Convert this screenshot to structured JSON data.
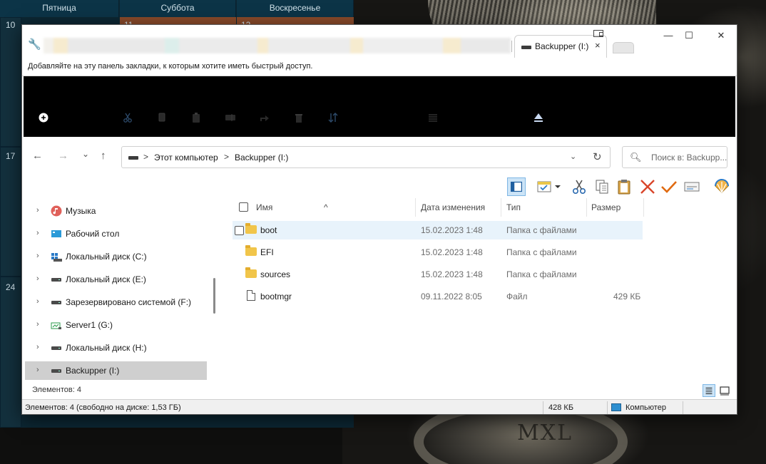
{
  "calendar": {
    "days": [
      "Пятница",
      "Суббота",
      "Воскресенье"
    ],
    "dates": [
      "10",
      "11",
      "12",
      "17",
      "24"
    ]
  },
  "wallpaper": {
    "text": "MXL"
  },
  "window": {
    "tabs": {
      "active_label": "Backupper (I:)",
      "close_glyph": "×"
    },
    "controls": {
      "minimize": "—",
      "maximize": "☐",
      "close": "✕"
    }
  },
  "bookmarks_bar": {
    "text": "Добавляйте на эту панель закладки, к которым хотите иметь быстрый доступ."
  },
  "ribbon": {
    "icons": [
      "new-icon",
      "cut-icon",
      "copy-icon",
      "paste-icon",
      "rename-icon",
      "share-icon",
      "delete-icon",
      "sort-icon",
      "view-icon",
      "eject-icon"
    ]
  },
  "nav": {
    "back": "←",
    "forward": "→",
    "recent": "⌄",
    "up": "↑",
    "breadcrumb": [
      "Этот компьютер",
      "Backupper (I:)"
    ],
    "separator": ">",
    "dropdown": "⌄",
    "refresh": "↻",
    "search_placeholder": "Поиск в: Backupp..."
  },
  "quick_commands": [
    "preview-pane-icon",
    "select-icon",
    "cut-icon",
    "copy-icon",
    "paste-icon",
    "delete-icon",
    "check-icon",
    "rename-icon",
    "shell-icon"
  ],
  "sidebar": {
    "items": [
      {
        "label": "Музыка",
        "icon": "music-icon",
        "selected": false
      },
      {
        "label": "Рабочий стол",
        "icon": "desktop-icon",
        "selected": false
      },
      {
        "label": "Локальный диск (C:)",
        "icon": "windows-drive-icon",
        "selected": false
      },
      {
        "label": "Локальный диск (E:)",
        "icon": "drive-icon",
        "selected": false
      },
      {
        "label": "Зарезервировано системой (F:)",
        "icon": "drive-icon",
        "selected": false
      },
      {
        "label": "Server1 (G:)",
        "icon": "network-drive-icon",
        "selected": false
      },
      {
        "label": "Локальный диск (H:)",
        "icon": "drive-icon",
        "selected": false
      },
      {
        "label": "Backupper (I:)",
        "icon": "drive-icon",
        "selected": true
      }
    ]
  },
  "file_list": {
    "columns": [
      "Имя",
      "Дата изменения",
      "Тип",
      "Размер"
    ],
    "sort_indicator": "^",
    "rows": [
      {
        "name": "boot",
        "date": "15.02.2023 1:48",
        "type": "Папка с файлами",
        "size": "",
        "kind": "folder",
        "highlighted": true
      },
      {
        "name": "EFI",
        "date": "15.02.2023 1:48",
        "type": "Папка с файлами",
        "size": "",
        "kind": "folder",
        "highlighted": false
      },
      {
        "name": "sources",
        "date": "15.02.2023 1:48",
        "type": "Папка с файлами",
        "size": "",
        "kind": "folder",
        "highlighted": false
      },
      {
        "name": "bootmgr",
        "date": "09.11.2022 8:05",
        "type": "Файл",
        "size": "429 КБ",
        "kind": "file",
        "highlighted": false
      }
    ]
  },
  "status_row": {
    "count": "Элементов: 4"
  },
  "status_bar": {
    "summary": "Элементов: 4 (свободно на диске: 1,53 ГБ)",
    "size": "428 КБ",
    "location": "Компьютер"
  },
  "colors": {
    "accent": "#0078d4",
    "folder": "#f1c54a",
    "row_highlight": "#e8f3fb",
    "calendar_bg": "#0c2733"
  }
}
